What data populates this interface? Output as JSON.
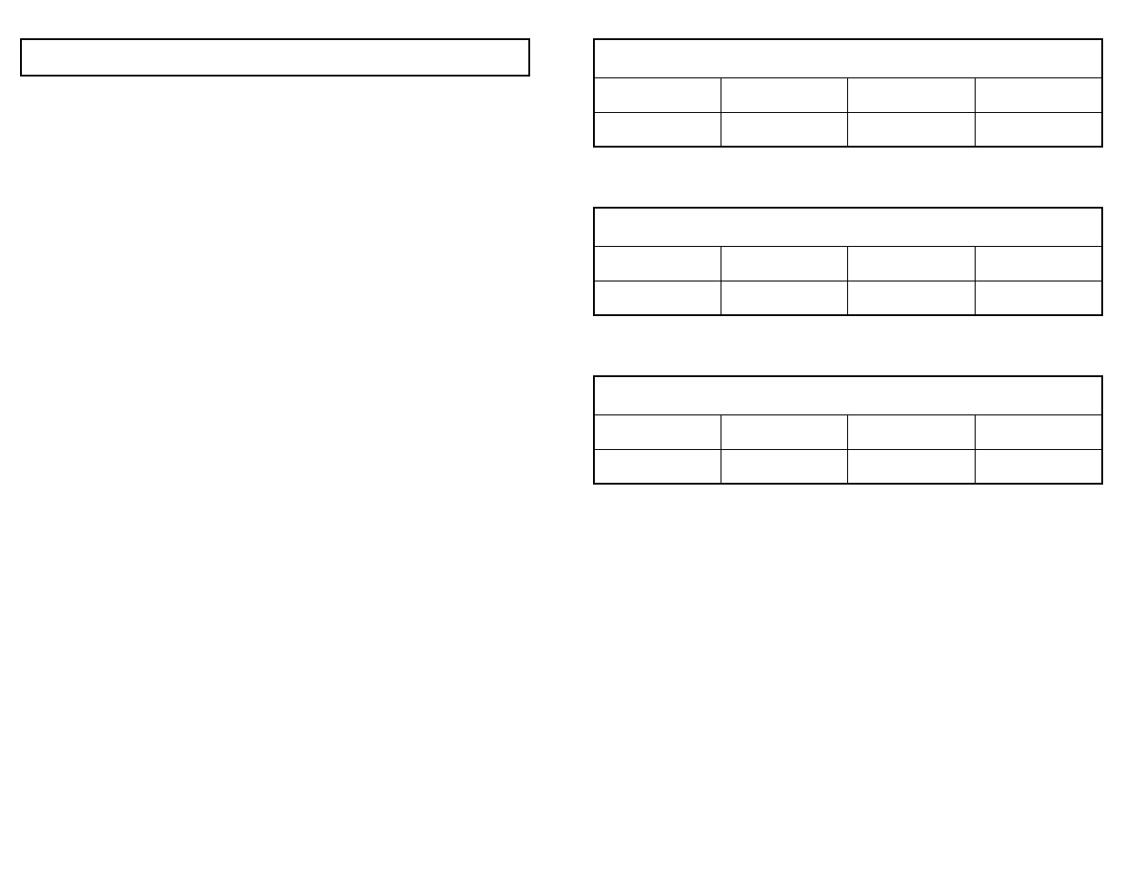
{
  "left_box": {
    "content": ""
  },
  "tables": [
    {
      "title": "",
      "rows": [
        [
          "",
          "",
          "",
          ""
        ],
        [
          "",
          "",
          "",
          ""
        ]
      ]
    },
    {
      "title": "",
      "rows": [
        [
          "",
          "",
          "",
          ""
        ],
        [
          "",
          "",
          "",
          ""
        ]
      ]
    },
    {
      "title": "",
      "rows": [
        [
          "",
          "",
          "",
          ""
        ],
        [
          "",
          "",
          "",
          ""
        ]
      ]
    }
  ]
}
